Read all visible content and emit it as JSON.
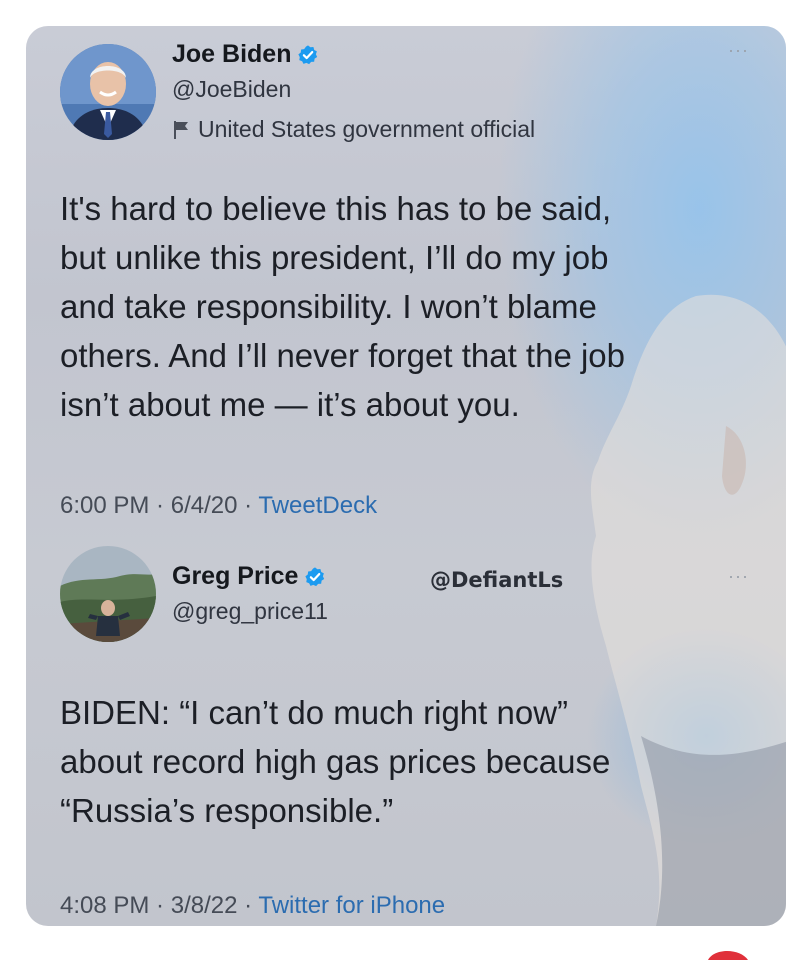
{
  "tweets": [
    {
      "name": "Joe Biden",
      "handle": "@JoeBiden",
      "label": "United States government official",
      "text_lines": [
        "It's hard to believe this has to be said,",
        "but unlike this president, I’ll do my job",
        "and take responsibility. I won’t blame",
        "others. And I’ll never forget that the job",
        "isn’t about me — it’s about you."
      ],
      "time": "6:00 PM",
      "date": "6/4/20",
      "source": "TweetDeck",
      "more": "···"
    },
    {
      "name": "Greg Price",
      "handle": "@greg_price11",
      "text_lines": [
        "BIDEN: “I can’t do much right now”",
        "about record high gas prices because",
        "“Russia’s responsible.”"
      ],
      "time": "4:08 PM",
      "date": "3/8/22",
      "source": "Twitter for iPhone",
      "more": "···"
    }
  ],
  "watermark": "@DefiantLs",
  "separator": " · ",
  "icons": {
    "verified": "verified-badge-icon",
    "flag": "flag-icon"
  },
  "colors": {
    "verified_blue": "#1d9bf0",
    "source_blue": "#2b6cb0"
  }
}
